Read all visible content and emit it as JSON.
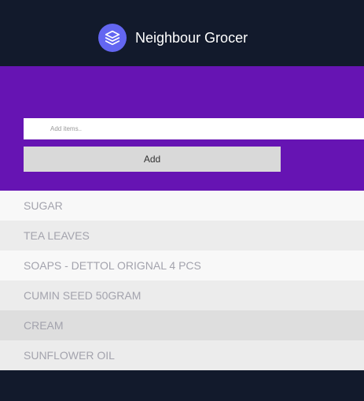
{
  "header": {
    "brand": "Neighbour Grocer",
    "logo_icon": "layers-icon",
    "logo_color": "#6366f1"
  },
  "form": {
    "placeholder": "Add items..",
    "value": "",
    "button_label": "Add"
  },
  "items": [
    {
      "label": "SUGAR",
      "highlighted": false
    },
    {
      "label": "TEA LEAVES",
      "highlighted": false
    },
    {
      "label": "SOAPS - DETTOL ORIGNAL 4 PCS",
      "highlighted": false
    },
    {
      "label": "CUMIN SEED 50GRAM",
      "highlighted": false
    },
    {
      "label": "CREAM",
      "highlighted": true
    },
    {
      "label": "SUNFLOWER OIL",
      "highlighted": false
    }
  ],
  "colors": {
    "background": "#121a2c",
    "panel": "#6614b3",
    "accent": "#6366f1"
  }
}
